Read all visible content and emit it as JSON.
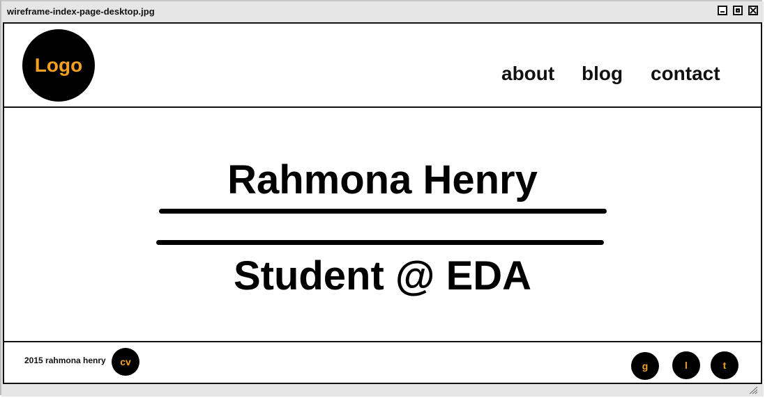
{
  "window": {
    "title": "wireframe-index-page-desktop.jpg"
  },
  "header": {
    "logo_text": "Logo",
    "nav": [
      {
        "label": "about"
      },
      {
        "label": "blog"
      },
      {
        "label": "contact"
      }
    ]
  },
  "hero": {
    "name": "Rahmona Henry",
    "role": "Student @ EDA"
  },
  "footer": {
    "copyright": "2015 rahmona henry",
    "cv_label": "cv",
    "social": [
      {
        "label": "g"
      },
      {
        "label": "l"
      },
      {
        "label": "t"
      }
    ]
  },
  "colors": {
    "accent": "#f5a11f",
    "dark": "#000000",
    "chrome": "#e6e6e6"
  }
}
